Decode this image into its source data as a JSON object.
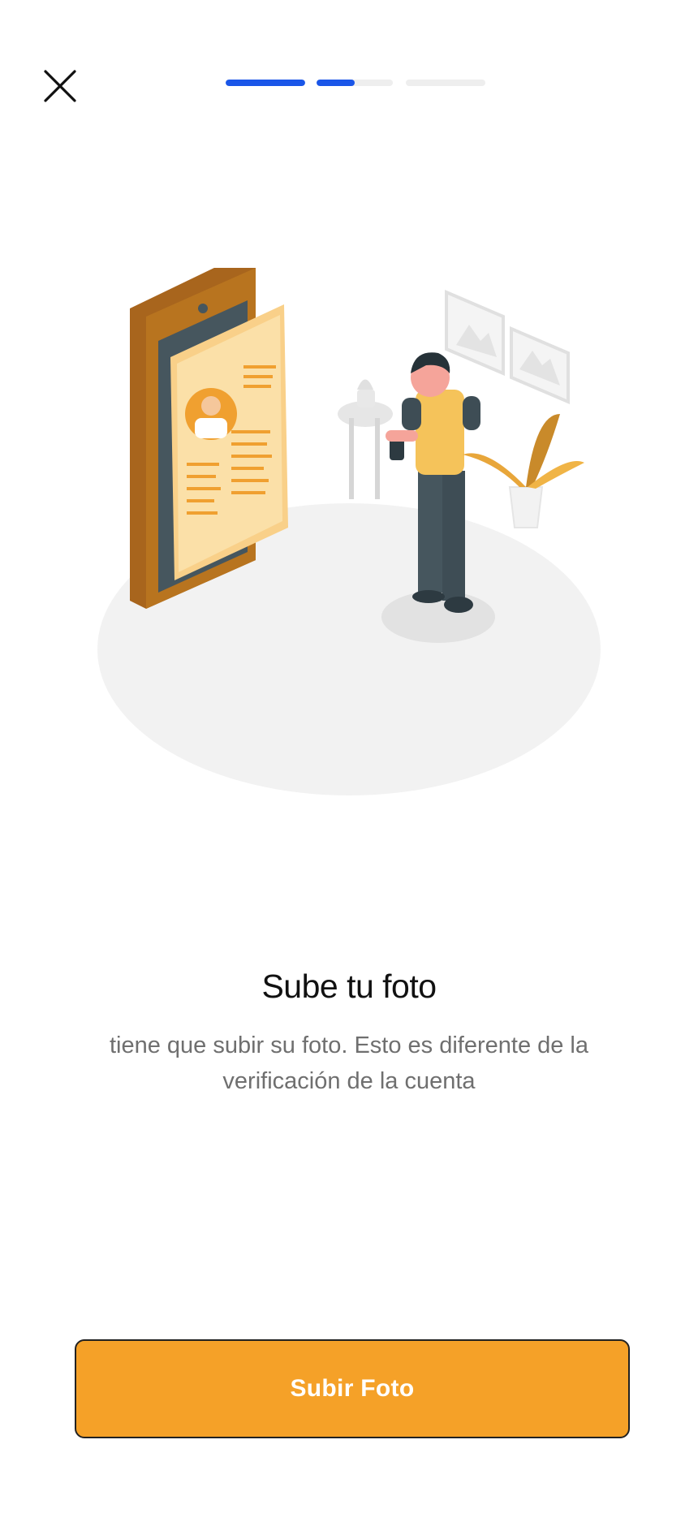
{
  "header": {
    "close_icon": "close-icon",
    "progress": {
      "segments": 3,
      "active_step": 2,
      "segment_fill": [
        1.0,
        0.5,
        0.0
      ],
      "color_active": "#1a56e8",
      "color_inactive": "#eeeeee"
    }
  },
  "illustration": {
    "subject": "person-holding-phone-with-profile-card"
  },
  "content": {
    "title": "Sube tu foto",
    "subtitle": "tiene que subir su foto. Esto es diferente de la verificación de la cuenta"
  },
  "actions": {
    "upload_label": "Subir Foto",
    "upload_color": "#f5a128"
  }
}
